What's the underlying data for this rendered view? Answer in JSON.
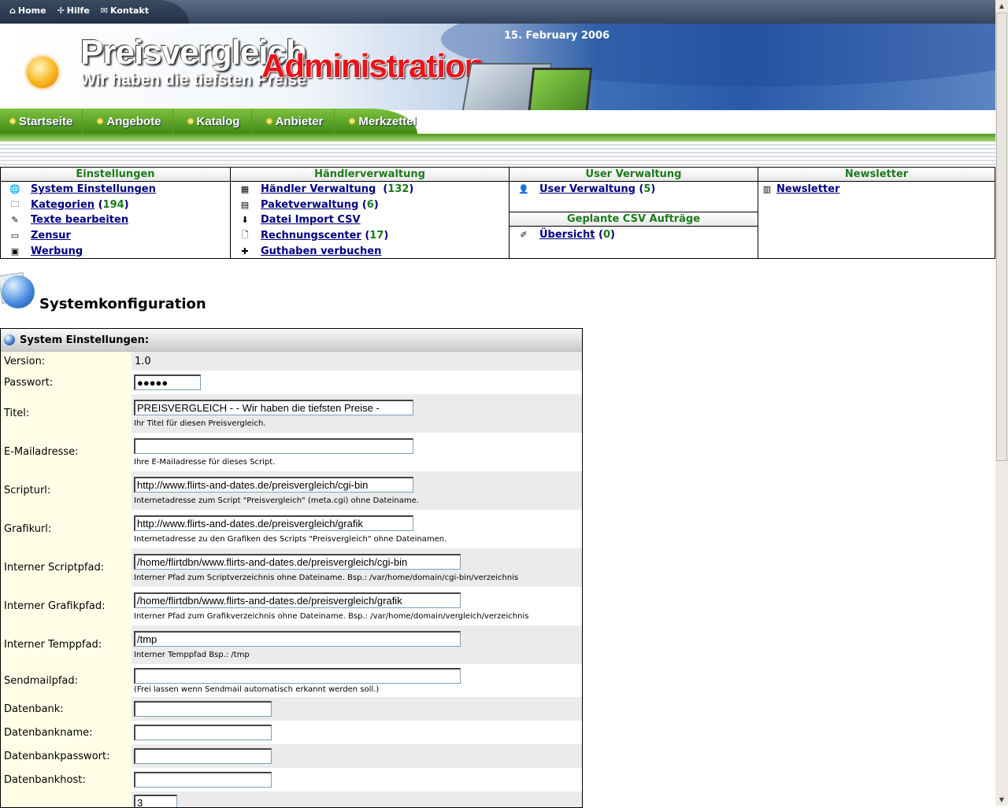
{
  "topnav": {
    "home": "Home",
    "help": "Hilfe",
    "contact": "Kontakt"
  },
  "header": {
    "date": "15. February 2006",
    "brand": "Preisvergleich",
    "tagline": "Wir haben die tiefsten Preise",
    "overlay": "Administration"
  },
  "mainnav": [
    "Startseite",
    "Angebote",
    "Katalog",
    "Anbieter",
    "Merkzettel"
  ],
  "menu": {
    "einstellungen": {
      "title": "Einstellungen",
      "items": [
        {
          "label": "System Einstellungen",
          "count": ""
        },
        {
          "label": "Kategorien",
          "count": "194"
        },
        {
          "label": "Texte bearbeiten",
          "count": ""
        },
        {
          "label": "Zensur",
          "count": ""
        },
        {
          "label": "Werbung",
          "count": ""
        }
      ]
    },
    "haendler": {
      "title": "Händlerverwaltung",
      "items": [
        {
          "label": "Händler Verwaltung",
          "count": "132"
        },
        {
          "label": "Paketverwaltung",
          "count": "6"
        },
        {
          "label": "Datei Import CSV",
          "count": ""
        },
        {
          "label": "Rechnungscenter",
          "count": "17"
        },
        {
          "label": "Guthaben verbuchen",
          "count": ""
        }
      ]
    },
    "user": {
      "title": "User Verwaltung",
      "item": {
        "label": "User Verwaltung",
        "count": "5"
      }
    },
    "csv": {
      "title": "Geplante CSV Aufträge",
      "item": {
        "label": "Übersicht",
        "count": "0"
      }
    },
    "newsletter": {
      "title": "Newsletter",
      "item": {
        "label": "Newsletter"
      }
    }
  },
  "page_title": "Systemkonfiguration",
  "form": {
    "title": "System Einstellungen:",
    "version_label": "Version:",
    "version_value": "1.0",
    "password_label": "Passwort:",
    "password_value": "●●●●●",
    "title_label": "Titel:",
    "title_value": "PREISVERGLEICH - - Wir haben die tiefsten Preise -",
    "title_hint": "Ihr Titel für diesen Preisvergleich.",
    "email_label": "E-Mailadresse:",
    "email_value": "",
    "email_hint": "Ihre E-Mailadresse für dieses Script.",
    "scripturl_label": "Scripturl:",
    "scripturl_value": "http://www.flirts-and-dates.de/preisvergleich/cgi-bin",
    "scripturl_hint": "Internetadresse zum Script \"Preisvergleich\" (meta.cgi) ohne Dateiname.",
    "grafikurl_label": "Grafikurl:",
    "grafikurl_value": "http://www.flirts-and-dates.de/preisvergleich/grafik",
    "grafikurl_hint": "Internetadresse zu den Grafiken des Scripts \"Preisvergleich\" ohne Dateinamen.",
    "scriptpfad_label": "Interner Scriptpfad:",
    "scriptpfad_value": "/home/flirtdbn/www.flirts-and-dates.de/preisvergleich/cgi-bin",
    "scriptpfad_hint": "Interner Pfad zum Scriptverzeichnis ohne Dateiname. Bsp.: /var/home/domain/cgi-bin/verzeichnis",
    "grafikpfad_label": "Interner Grafikpfad:",
    "grafikpfad_value": "/home/flirtdbn/www.flirts-and-dates.de/preisvergleich/grafik",
    "grafikpfad_hint": "Interner Pfad zum Grafikverzeichnis ohne Dateiname. Bsp.: /var/home/domain/vergleich/verzeichnis",
    "temppfad_label": "Interner Temppfad:",
    "temppfad_value": "/tmp",
    "temppfad_hint": "Interner Temppfad Bsp.: /tmp",
    "sendmail_label": "Sendmailpfad:",
    "sendmail_value": "",
    "sendmail_hint": "(Frei lassen wenn Sendmail automatisch erkannt werden soll.)",
    "db_label": "Datenbank:",
    "db_value": "",
    "dbname_label": "Datenbankname:",
    "dbname_value": "",
    "dbpass_label": "Datenbankpasswort:",
    "dbpass_value": "",
    "dbhost_label": "Datenbankhost:",
    "dbhost_value": "",
    "last_value": "3"
  }
}
